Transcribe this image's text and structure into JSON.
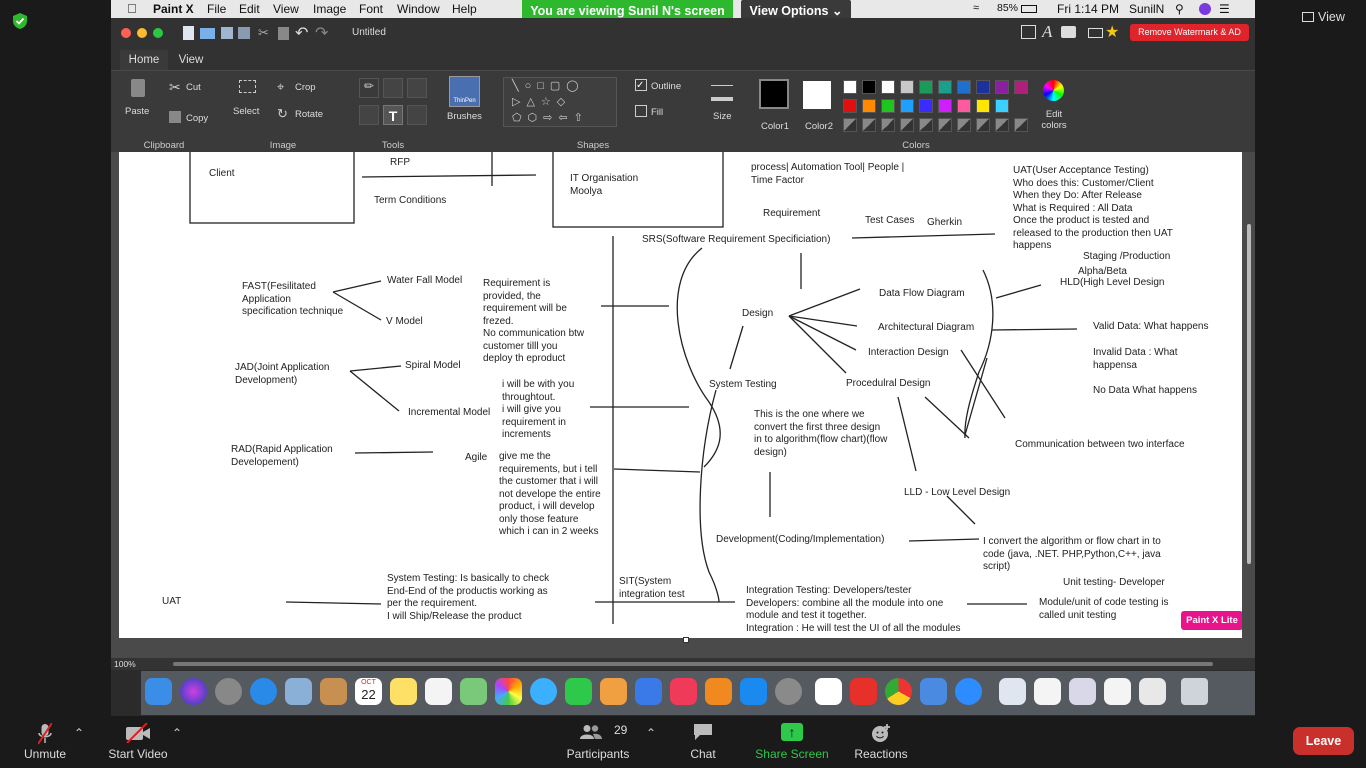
{
  "zoom_top": {
    "view_label": "View",
    "shield_color": "#2eb82e"
  },
  "mac_menu": {
    "app": "Paint X",
    "items": [
      "File",
      "Edit",
      "View",
      "Image",
      "Font",
      "Window",
      "Help"
    ],
    "battery": "85%",
    "clock": "Fri 1:14 PM",
    "user": "SunilN"
  },
  "banner": {
    "viewing": "You are viewing Sunil N's screen",
    "view_options": "View Options"
  },
  "window": {
    "title": "Untitled",
    "watermark_button": "Remove Watermark & AD"
  },
  "ribbon_tabs": [
    "Home",
    "View"
  ],
  "ribbon": {
    "paste": "Paste",
    "cut": "Cut",
    "copy": "Copy",
    "clipboard": "Clipboard",
    "select": "Select",
    "crop": "Crop",
    "rotate": "Rotate",
    "image": "Image",
    "tools": "Tools",
    "brushes": "Brushes",
    "brush_name": "ThinPen",
    "outline": "Outline",
    "fill": "Fill",
    "shapes": "Shapes",
    "size": "Size",
    "color1": "Color1",
    "color2": "Color2",
    "colors": "Colors",
    "edit_colors": "Edit colors",
    "palette_row1": [
      "#ffffff",
      "#000000",
      "#ffffff",
      "#c8c8c8",
      "#1a9b5a",
      "#1aa08a",
      "#1f6fd0",
      "#1e2f9e",
      "#8a1fa0",
      "#b01f7a"
    ],
    "palette_row2": [
      "#e01010",
      "#ff8a00",
      "#1fc41f",
      "#1fa0ff",
      "#3a2cff",
      "#d01fff",
      "#ff5aa0",
      "#ffe600",
      "#3ad0ff"
    ]
  },
  "canvas": {
    "texts": [
      "Client",
      "RFP",
      "Term Conditions",
      "IT Organisation\nMoolya",
      "process| Automation Tool| People |\nTime Factor",
      "Requirement",
      "Test Cases",
      "Gherkin",
      "UAT(User Acceptance Testing)\nWho does this: Customer/Client\nWhen they Do: After Release\nWhat is Required : All Data\nOnce the product is tested and\nreleased to the production then UAT\nhappens",
      "SRS(Software Requirement Specificiation)",
      "Staging /Production",
      "Alpha/Beta",
      "HLD(High Level Design",
      "FAST(Fesilitated\nApplication\nspecification technique",
      "Water Fall Model",
      "V Model",
      "Requirement is\nprovided, the\nrequirement will be\nfrezed.\nNo communication btw\ncustomer tilll you\ndeploy th eproduct",
      "Design",
      "Data Flow Diagram",
      "Architectural Diagram",
      "Valid Data: What happens",
      "Interaction Design",
      "Invalid Data : What\nhappensa",
      "JAD(Joint Application\nDevelopment)",
      "Spiral Model",
      "i will be with you\nthroughtout.\ni will give you\nrequirement in\nincrements",
      "System Testing",
      "Procedulral Design",
      "No Data What happens",
      "Incremental Model",
      "This is the one where we\nconvert the first three design\nin to algorithm(flow chart)(flow\ndesign)",
      "Communication between two interface",
      "RAD(Rapid Application\nDevelopement)",
      "Agile",
      "give me the\nrequirements, but i tell\nthe customer that i will\nnot develope the entire\nproduct, i will develop\nonly those feature\nwhich i can in 2 weeks",
      "LLD - Low Level Design",
      "Development(Coding/Implementation)",
      "I convert the algorithm or flow chart in to\ncode (java, .NET. PHP,Python,C++, java\nscript)",
      "SIT(System\nintegration test",
      "System Testing: Is basically to check\nEnd-End of the productis working as\nper the requirement.\nI will Ship/Release the product",
      "UAT",
      "Unit testing- Developer",
      "Integration Testing: Developers/tester\nDevelopers: combine all the module into one\nmodule and test it together.\nIntegration : He will test the UI of all the modules",
      "Module/unit of code testing is\ncalled unit testing"
    ],
    "badge": "Paint X Lite"
  },
  "status": {
    "zoom": "100%"
  },
  "dock": {
    "calendar_month": "OCT",
    "calendar_day": "22"
  },
  "zoom_bar": {
    "unmute": "Unmute",
    "start_video": "Start Video",
    "participants_count": "29",
    "participants": "Participants",
    "chat": "Chat",
    "share_screen": "Share Screen",
    "reactions": "Reactions",
    "leave": "Leave"
  }
}
